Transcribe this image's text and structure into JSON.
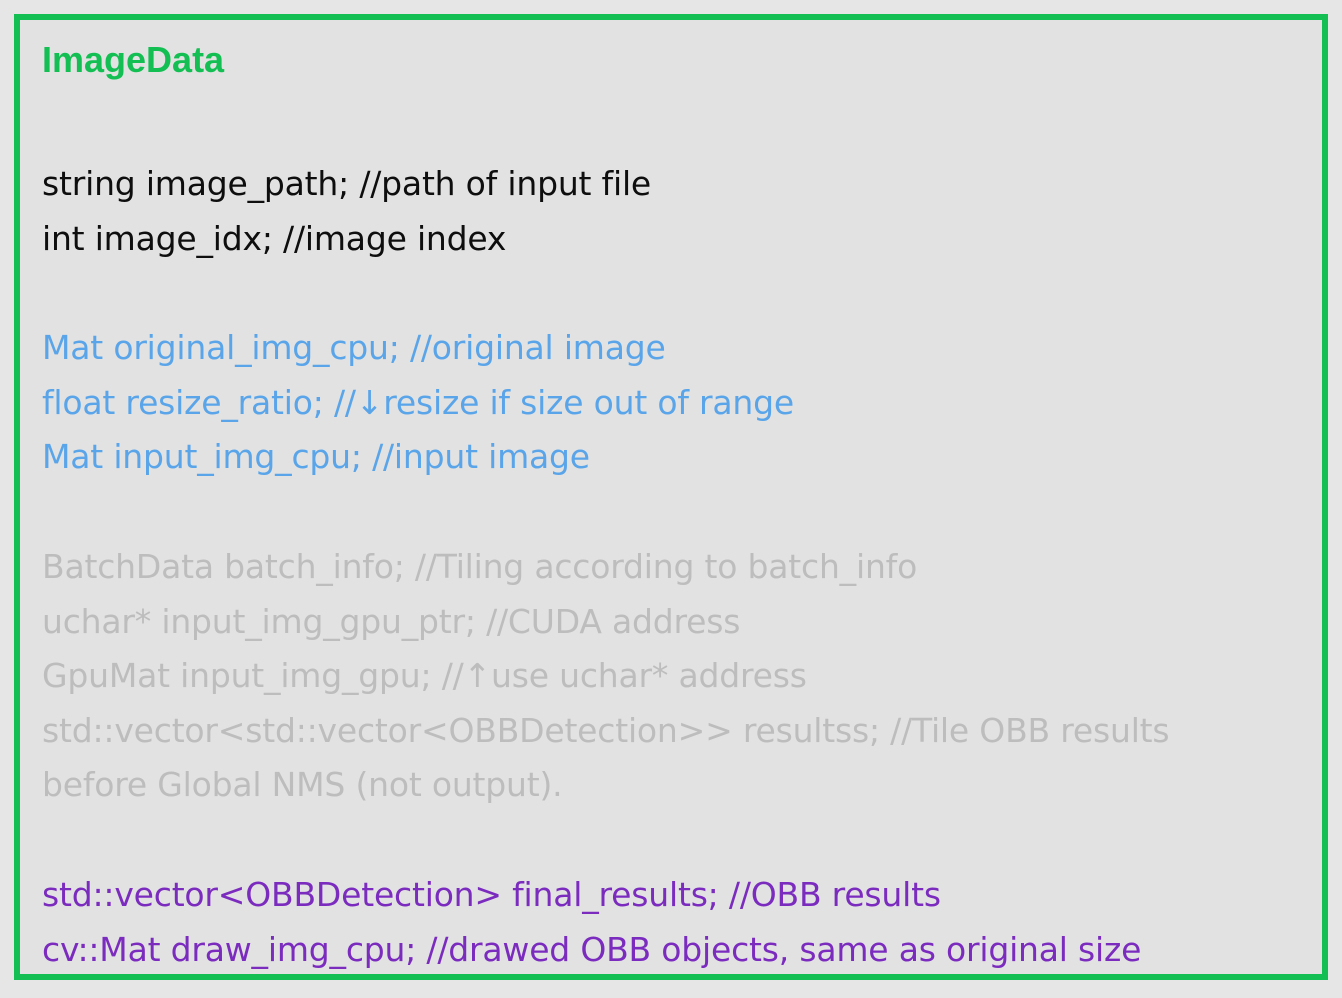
{
  "title": "ImageData",
  "colors": {
    "border": "#13bf52",
    "title": "#13bf52",
    "background": "#e2e2e2",
    "basic_fields": "#0e0e0e",
    "cpu_fields": "#5aa5ea",
    "gpu_fields": "#bdbdbd",
    "output_fields": "#7b2cbf"
  },
  "groups": {
    "basic": [
      "string image_path; //path of input file",
      "int image_idx; //image index"
    ],
    "cpu": [
      "Mat original_img_cpu; //original image",
      "float resize_ratio; //↓resize if size out of range",
      "Mat input_img_cpu; //input image"
    ],
    "gpu": [
      "BatchData batch_info; //Tiling according to batch_info",
      "uchar* input_img_gpu_ptr; //CUDA address",
      "GpuMat input_img_gpu; //↑use uchar* address",
      "std::vector<std::vector<OBBDetection>> resultss; //Tile OBB results",
      "before Global NMS (not output)."
    ],
    "output": [
      "std::vector<OBBDetection> final_results; //OBB results",
      "cv::Mat draw_img_cpu; //drawed OBB objects, same as original size"
    ]
  }
}
